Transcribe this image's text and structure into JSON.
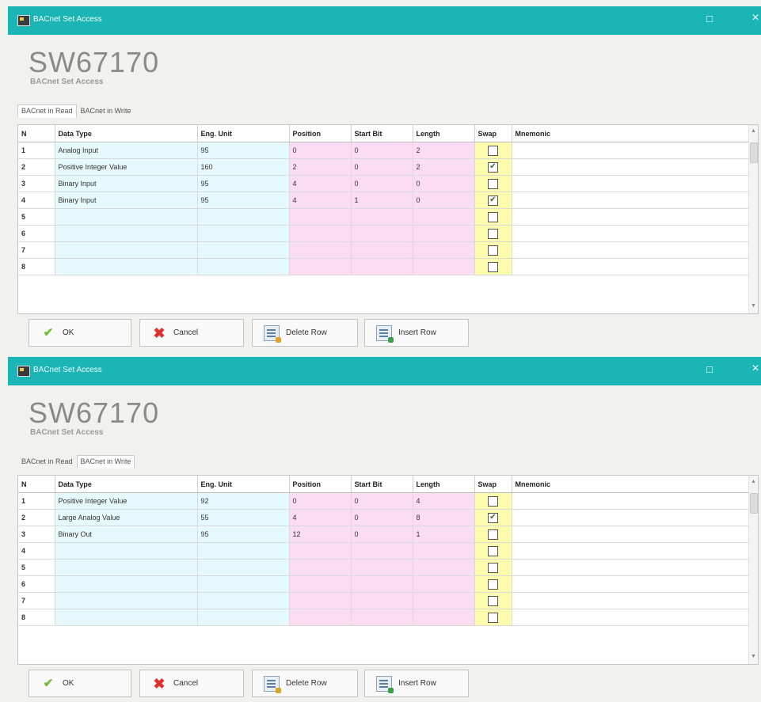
{
  "windows": [
    {
      "title": "BACnet Set Access",
      "product": "SW67170",
      "subtitle": "BACnet Set Access",
      "tabs": [
        {
          "label": "BACnet in Read",
          "active": true
        },
        {
          "label": "BACnet in Write",
          "active": false
        }
      ],
      "columns": [
        "N",
        "Data Type",
        "Eng. Unit",
        "Position",
        "Start Bit",
        "Length",
        "Swap",
        "Mnemonic"
      ],
      "rows": [
        {
          "n": "1",
          "data_type": "Analog Input",
          "eng_unit": "95",
          "position": "0",
          "start_bit": "0",
          "length": "2",
          "swap": false,
          "mnemonic": ""
        },
        {
          "n": "2",
          "data_type": "Positive Integer Value",
          "eng_unit": "160",
          "position": "2",
          "start_bit": "0",
          "length": "2",
          "swap": true,
          "mnemonic": ""
        },
        {
          "n": "3",
          "data_type": "Binary Input",
          "eng_unit": "95",
          "position": "4",
          "start_bit": "0",
          "length": "0",
          "swap": false,
          "mnemonic": ""
        },
        {
          "n": "4",
          "data_type": "Binary Input",
          "eng_unit": "95",
          "position": "4",
          "start_bit": "1",
          "length": "0",
          "swap": true,
          "mnemonic": ""
        },
        {
          "n": "5",
          "data_type": "",
          "eng_unit": "",
          "position": "",
          "start_bit": "",
          "length": "",
          "swap": false,
          "mnemonic": ""
        },
        {
          "n": "6",
          "data_type": "",
          "eng_unit": "",
          "position": "",
          "start_bit": "",
          "length": "",
          "swap": false,
          "mnemonic": ""
        },
        {
          "n": "7",
          "data_type": "",
          "eng_unit": "",
          "position": "",
          "start_bit": "",
          "length": "",
          "swap": false,
          "mnemonic": ""
        },
        {
          "n": "8",
          "data_type": "",
          "eng_unit": "",
          "position": "",
          "start_bit": "",
          "length": "",
          "swap": false,
          "mnemonic": ""
        }
      ],
      "buttons": {
        "ok": "OK",
        "cancel": "Cancel",
        "delete_row": "Delete Row",
        "insert_row": "Insert Row"
      }
    },
    {
      "title": "BACnet Set Access",
      "product": "SW67170",
      "subtitle": "BACnet Set Access",
      "tabs": [
        {
          "label": "BACnet in Read",
          "active": false
        },
        {
          "label": "BACnet in Write",
          "active": true
        }
      ],
      "columns": [
        "N",
        "Data Type",
        "Eng. Unit",
        "Position",
        "Start Bit",
        "Length",
        "Swap",
        "Mnemonic"
      ],
      "rows": [
        {
          "n": "1",
          "data_type": "Positive Integer Value",
          "eng_unit": "92",
          "position": "0",
          "start_bit": "0",
          "length": "4",
          "swap": false,
          "mnemonic": ""
        },
        {
          "n": "2",
          "data_type": "Large Analog Value",
          "eng_unit": "55",
          "position": "4",
          "start_bit": "0",
          "length": "8",
          "swap": true,
          "mnemonic": ""
        },
        {
          "n": "3",
          "data_type": "Binary Out",
          "eng_unit": "95",
          "position": "12",
          "start_bit": "0",
          "length": "1",
          "swap": false,
          "mnemonic": ""
        },
        {
          "n": "4",
          "data_type": "",
          "eng_unit": "",
          "position": "",
          "start_bit": "",
          "length": "",
          "swap": false,
          "mnemonic": ""
        },
        {
          "n": "5",
          "data_type": "",
          "eng_unit": "",
          "position": "",
          "start_bit": "",
          "length": "",
          "swap": false,
          "mnemonic": ""
        },
        {
          "n": "6",
          "data_type": "",
          "eng_unit": "",
          "position": "",
          "start_bit": "",
          "length": "",
          "swap": false,
          "mnemonic": ""
        },
        {
          "n": "7",
          "data_type": "",
          "eng_unit": "",
          "position": "",
          "start_bit": "",
          "length": "",
          "swap": false,
          "mnemonic": ""
        },
        {
          "n": "8",
          "data_type": "",
          "eng_unit": "",
          "position": "",
          "start_bit": "",
          "length": "",
          "swap": false,
          "mnemonic": ""
        }
      ],
      "buttons": {
        "ok": "OK",
        "cancel": "Cancel",
        "delete_row": "Delete Row",
        "insert_row": "Insert Row"
      }
    }
  ],
  "colors": {
    "titlebar": "#1bb5b5",
    "data_type_col": "#e6fafd",
    "position_col": "#fbdcf3",
    "swap_col": "#fdfcae"
  },
  "icons": [
    "app-icon",
    "maximize-icon",
    "close-icon",
    "checkmark-icon",
    "cancel-x-icon",
    "delete-row-icon",
    "insert-row-icon"
  ]
}
